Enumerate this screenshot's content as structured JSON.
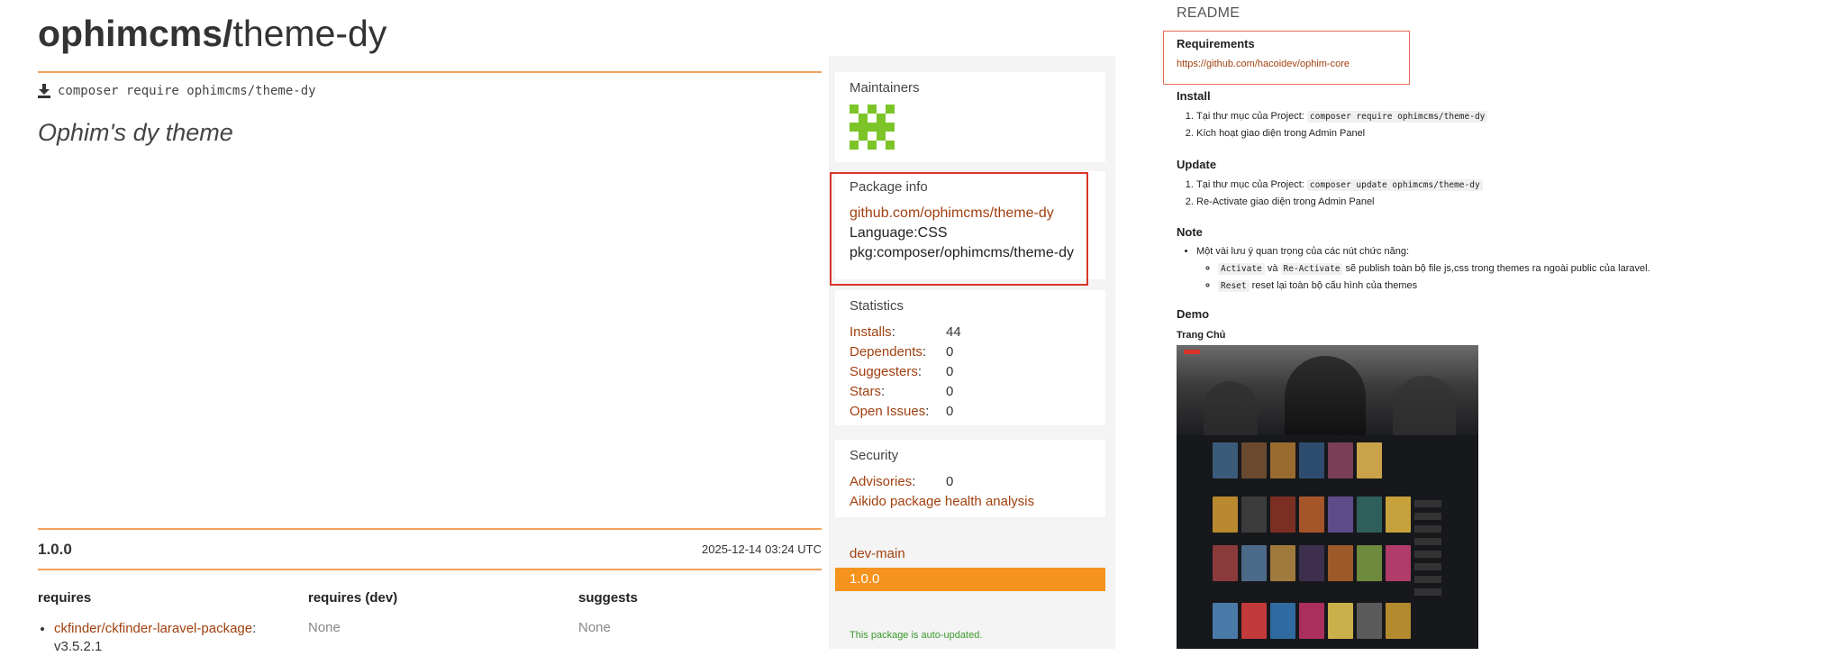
{
  "package": {
    "vendor": "ophimcms/",
    "name": "theme-dy",
    "install_command": "composer require ophimcms/theme-dy",
    "description": "Ophim's dy theme"
  },
  "version": {
    "number": "1.0.0",
    "date": "2025-12-14 03:24 UTC"
  },
  "dependencies": {
    "requires_label": "requires",
    "requires_dev_label": "requires (dev)",
    "suggests_label": "suggests",
    "requires_item_name": "ckfinder/ckfinder-laravel-package",
    "requires_item_version": ": v3.5.2.1",
    "requires_dev_value": "None",
    "suggests_value": "None"
  },
  "sidebar": {
    "maintainers_label": "Maintainers",
    "package_info_label": "Package info",
    "repo_link": "github.com/ophimcms/theme-dy",
    "language": "Language:CSS",
    "pkg": "pkg:composer/ophimcms/theme-dy",
    "statistics_label": "Statistics",
    "stats": [
      {
        "label": "Installs",
        "value": "44"
      },
      {
        "label": "Dependents",
        "value": "0"
      },
      {
        "label": "Suggesters",
        "value": "0"
      },
      {
        "label": "Stars",
        "value": "0"
      },
      {
        "label": "Open Issues",
        "value": "0"
      }
    ],
    "security_label": "Security",
    "advisories_label": "Advisories",
    "advisories_value": "0",
    "aikido_link": "Aikido package health analysis",
    "branches": {
      "dev": "dev-main",
      "active": "1.0.0"
    },
    "auto_updated": "This package is auto-updated."
  },
  "readme": {
    "heading": "README",
    "requirements_title": "Requirements",
    "requirements_link": "https://github.com/hacoidev/ophim-core",
    "install_title": "Install",
    "install_1_text": "Tại thư mục của Project:",
    "install_1_code": "composer require ophimcms/theme-dy",
    "install_2": "Kích hoạt giao diện trong Admin Panel",
    "update_title": "Update",
    "update_1_text": "Tại thư mục của Project:",
    "update_1_code": "composer update ophimcms/theme-dy",
    "update_2": "Re-Activate giao diện trong Admin Panel",
    "note_title": "Note",
    "note_1": "Một vài lưu ý quan trọng của các nút chức năng:",
    "note_activate_code": "Activate",
    "note_and": "và",
    "note_reactivate_code": "Re-Activate",
    "note_activate_text": "sẽ publish toàn bộ file js,css trong themes ra ngoài public của laravel.",
    "note_reset_code": "Reset",
    "note_reset_text": "reset lại toàn bộ cấu hình của themes",
    "demo_title": "Demo",
    "demo_home": "Trang Chủ"
  },
  "colors": {
    "accent_orange": "#f5931e",
    "link_brown": "#a0400f",
    "rule_orange": "#f4a259",
    "highlight_red": "#d9352a",
    "avatar_green": "#7cc427"
  }
}
